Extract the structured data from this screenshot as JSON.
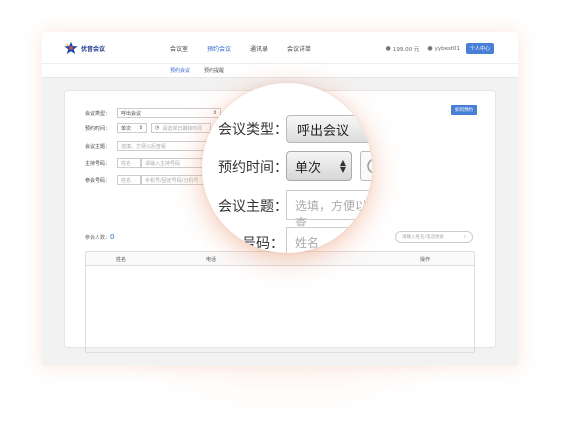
{
  "brand": {
    "name": "优音会议"
  },
  "nav": {
    "items": [
      "会议室",
      "预约会议",
      "通讯录",
      "会议详单"
    ],
    "active_index": 1
  },
  "user": {
    "balance": "199.00 元",
    "username": "yybest01",
    "personal_center": "个人中心"
  },
  "subtabs": {
    "items": [
      "预约会议",
      "预约提醒"
    ],
    "active_index": 0
  },
  "form": {
    "type_label": "会议类型：",
    "type_value": "呼出会议",
    "time_label": "预约时间：",
    "time_mode": "单次",
    "time_placeholder": "请选择日期和时间",
    "subject_label": "会议主题：",
    "subject_placeholder": "选填，方便以后查看",
    "host_label": "主持号码：",
    "host_name_placeholder": "姓名",
    "host_phone_placeholder": "请输入主持号码",
    "member_label": "参会号码：",
    "member_name_placeholder": "姓名",
    "member_phone_placeholder": "手机号/固定号码/分机号"
  },
  "help_button": "如何预约",
  "participants": {
    "label": "参会人数：",
    "count": "0",
    "search_placeholder": "请输入姓名/电话搜索"
  },
  "table": {
    "headers": [
      "姓名",
      "电话",
      "操作"
    ]
  },
  "magnifier": {
    "type_label": "会议类型：",
    "type_value": "呼出会议",
    "time_label": "预约时间：",
    "time_mode": "单次",
    "subject_label": "会议主题：",
    "subject_placeholder": "选填，方便以后查",
    "host_label_tail": "号码：",
    "host_name_placeholder": "姓名"
  },
  "colors": {
    "accent": "#3366cc",
    "button": "#4a7fd8",
    "glow": "#f6c9b4"
  }
}
